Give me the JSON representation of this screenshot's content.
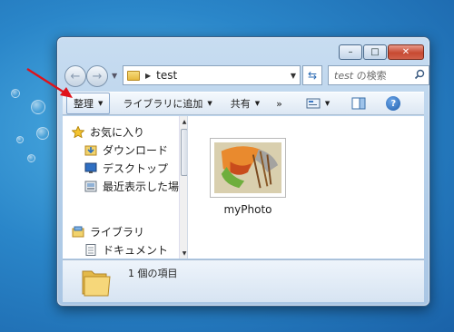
{
  "window": {
    "caption_buttons": [
      "minimize-icon",
      "maximize-icon",
      "close-icon"
    ]
  },
  "navigation": {
    "address_path": "test",
    "search_placeholder_bold": "test",
    "search_placeholder_rest": " の検索"
  },
  "toolbar": {
    "organize": "整理",
    "add_to_library": "ライブラリに追加",
    "share": "共有",
    "more": "»"
  },
  "nav_pane": {
    "items": [
      {
        "label": "お気に入り",
        "icon": "star-icon"
      },
      {
        "label": "ダウンロード",
        "icon": "downloads-icon"
      },
      {
        "label": "デスクトップ",
        "icon": "desktop-icon"
      },
      {
        "label": "最近表示した場所",
        "icon": "recent-places-icon"
      },
      {
        "label": "ライブラリ",
        "icon": "libraries-icon"
      },
      {
        "label": "ドキュメント",
        "icon": "documents-icon"
      }
    ]
  },
  "files": [
    {
      "name": "myPhoto",
      "type": "image"
    }
  ],
  "details": {
    "item_count": "1 個の項目"
  },
  "colors": {
    "desktop": "#2a86c9",
    "annotation_arrow": "#e0121a",
    "window_frame": "#b2cde8"
  }
}
